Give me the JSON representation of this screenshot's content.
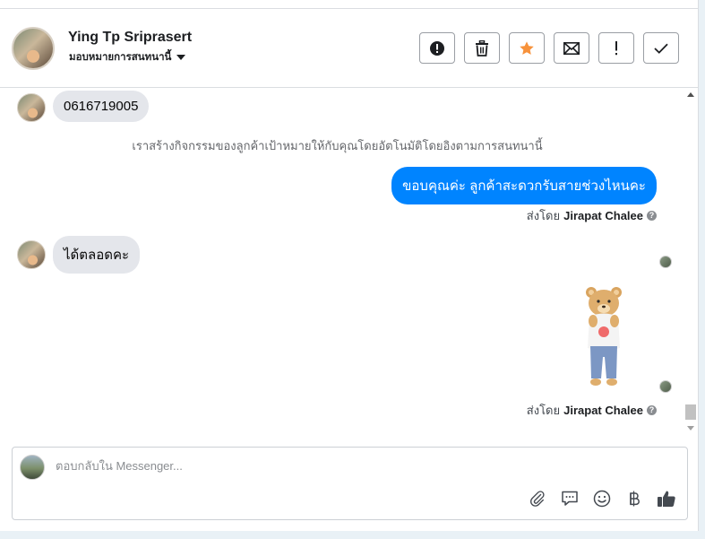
{
  "header": {
    "contact_name": "Ying Tp Sriprasert",
    "assign_label": "มอบหมายการสนทนานี้",
    "actions": [
      {
        "name": "report-spam-button",
        "icon": "alert-circle-icon"
      },
      {
        "name": "delete-button",
        "icon": "trash-icon"
      },
      {
        "name": "star-button",
        "icon": "star-icon"
      },
      {
        "name": "mark-unread-button",
        "icon": "envelope-icon"
      },
      {
        "name": "follow-up-button",
        "icon": "exclamation-icon"
      },
      {
        "name": "mark-done-button",
        "icon": "checkmark-icon"
      }
    ]
  },
  "conversation": {
    "messages": [
      {
        "from": "customer",
        "text": "0616719005"
      },
      {
        "from": "system",
        "text": "เราสร้างกิจกรรมของลูกค้าเป้าหมายให้กับคุณโดยอัตโนมัติโดยอิงตามการสนทนานี้"
      },
      {
        "from": "page",
        "text": "ขอบคุณค่ะ ลูกค้าสะดวกรับสายช่วงไหนคะ",
        "sent_by_prefix": "ส่งโดย",
        "sent_by_name": "Jirapat Chalee"
      },
      {
        "from": "customer",
        "text": "ได้ตลอดคะ"
      },
      {
        "from": "page",
        "type": "sticker",
        "sticker": "teddy-bear-sticker",
        "sent_by_prefix": "ส่งโดย",
        "sent_by_name": "Jirapat Chalee"
      }
    ]
  },
  "composer": {
    "placeholder": "ตอบกลับใน Messenger...",
    "tools": [
      "paperclip-icon",
      "speech-bubble-icon",
      "smiley-icon",
      "baht-icon",
      "thumbs-up-icon"
    ]
  },
  "colors": {
    "outgoing_bubble": "#0084ff",
    "incoming_bubble": "#e4e6eb",
    "star_accent": "#f7923b"
  }
}
